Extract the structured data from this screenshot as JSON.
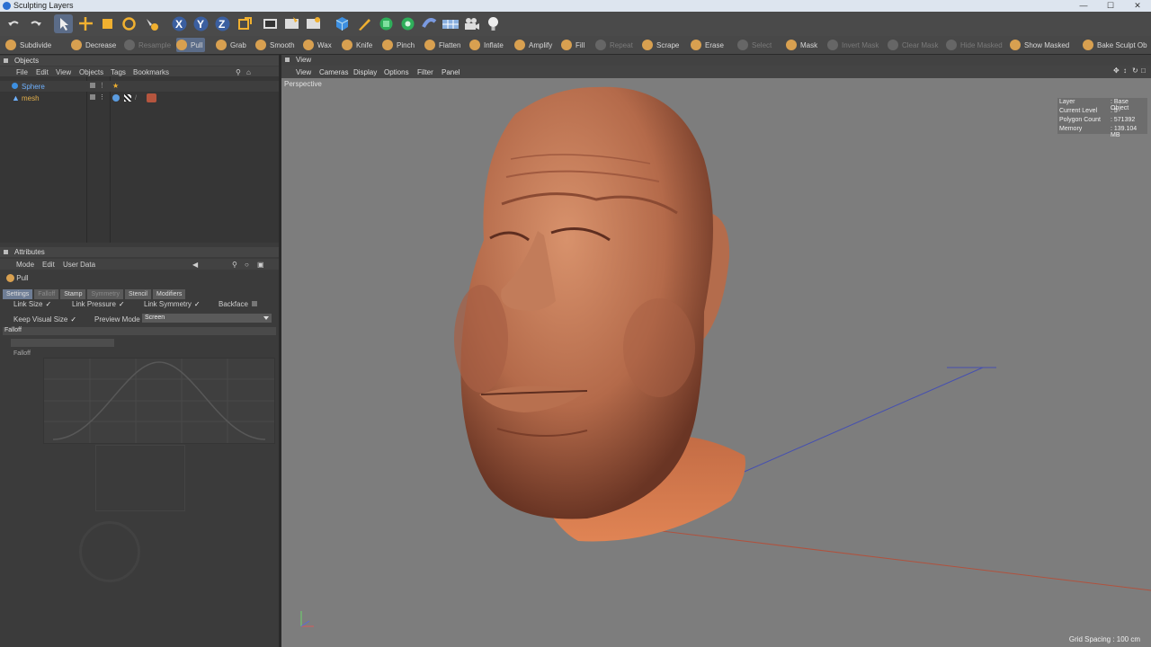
{
  "window": {
    "title": "Sculpting Layers",
    "controls": [
      "—",
      "☐",
      "✕"
    ]
  },
  "tools": [
    {
      "label": "Subdivide",
      "state": "normal"
    },
    {
      "label": "Decrease",
      "state": "normal"
    },
    {
      "label": "Resample",
      "state": "dim"
    },
    {
      "label": "Pull",
      "state": "active"
    },
    {
      "label": "Grab",
      "state": "normal"
    },
    {
      "label": "Smooth",
      "state": "normal"
    },
    {
      "label": "Wax",
      "state": "normal"
    },
    {
      "label": "Knife",
      "state": "normal"
    },
    {
      "label": "Pinch",
      "state": "normal"
    },
    {
      "label": "Flatten",
      "state": "normal"
    },
    {
      "label": "Inflate",
      "state": "normal"
    },
    {
      "label": "Amplify",
      "state": "normal"
    },
    {
      "label": "Fill",
      "state": "normal"
    },
    {
      "label": "Repeat",
      "state": "dim"
    },
    {
      "label": "Scrape",
      "state": "normal"
    },
    {
      "label": "Erase",
      "state": "normal"
    },
    {
      "label": "Select",
      "state": "dim"
    },
    {
      "label": "Mask",
      "state": "normal"
    },
    {
      "label": "Invert Mask",
      "state": "dim"
    },
    {
      "label": "Clear Mask",
      "state": "dim"
    },
    {
      "label": "Hide Masked",
      "state": "dim"
    },
    {
      "label": "Show Masked",
      "state": "normal"
    },
    {
      "label": "Bake Sculpt Ob",
      "state": "normal"
    }
  ],
  "objects_panel": {
    "title": "Objects",
    "menu": [
      "File",
      "Edit",
      "View",
      "Objects",
      "Tags",
      "Bookmarks"
    ],
    "items": [
      {
        "name": "Sphere",
        "color": "#d8d8d8"
      },
      {
        "name": "mesh",
        "color": "#e3b04b"
      }
    ]
  },
  "attributes_panel": {
    "title": "Attributes",
    "menu": [
      "Mode",
      "Edit",
      "User Data"
    ],
    "tool_name": "Pull",
    "tool_suffix": "",
    "tabs": [
      {
        "label": "Settings",
        "state": "sel"
      },
      {
        "label": "Falloff",
        "state": "dim"
      },
      {
        "label": "Stamp",
        "state": "normal"
      },
      {
        "label": "Symmetry",
        "state": "dim"
      },
      {
        "label": "Stencil",
        "state": "normal"
      },
      {
        "label": "Modifiers",
        "state": "normal"
      }
    ],
    "link_size": "Link Size",
    "link_pressure": "Link Pressure",
    "link_symmetry": "Link Symmetry",
    "backface": "Backface",
    "keep_visual_size": "Keep Visual Size",
    "preview_mode_label": "Preview Mode",
    "preview_mode_value": "Screen",
    "section": "Falloff",
    "falloff_label": "Falloff",
    "check": "✓"
  },
  "viewport": {
    "title": "View",
    "menu": [
      "View",
      "Cameras",
      "Display",
      "Options",
      "Filter",
      "Panel"
    ],
    "camera": "Perspective",
    "hud": [
      {
        "key": "Layer",
        "value": ": Base Object"
      },
      {
        "key": "Current Level",
        "value": ": 5"
      },
      {
        "key": "Polygon Count",
        "value": ": 571392"
      },
      {
        "key": "Memory",
        "value": ": 139.104 MB"
      }
    ],
    "grid_spacing": "Grid Spacing : 100 cm"
  }
}
